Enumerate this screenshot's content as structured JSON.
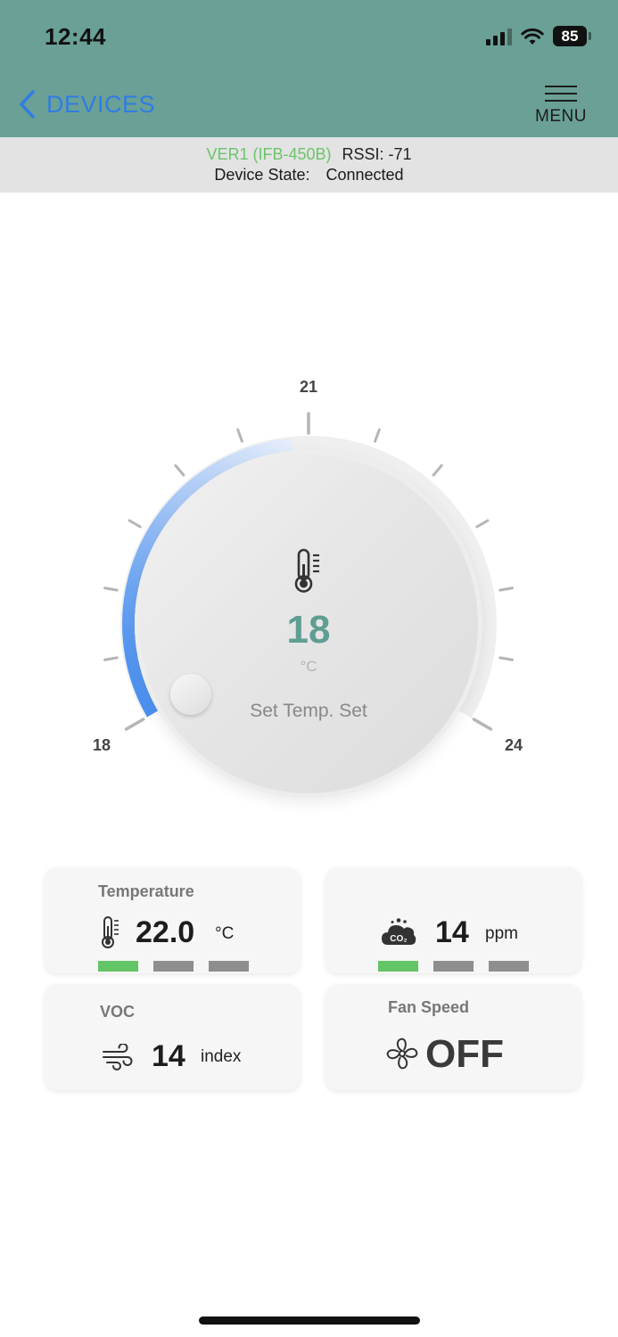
{
  "status_bar": {
    "time": "12:44",
    "battery": "85"
  },
  "nav": {
    "back_label": "DEVICES",
    "menu_label": "MENU"
  },
  "device_info": {
    "name": "VER1 (IFB-450B)",
    "rssi_label": "RSSI: -71",
    "state_label": "Device State:",
    "state_value": "Connected"
  },
  "dial": {
    "value": "18",
    "unit": "°C",
    "label": "Set Temp. Set",
    "min_label": "18",
    "mid_label": "21",
    "max_label": "24",
    "min": 18,
    "max": 24,
    "current": 18
  },
  "cards": {
    "temperature": {
      "title": "Temperature",
      "value": "22.0",
      "unit": "°C",
      "icon": "thermometer-icon",
      "level": 1,
      "level_count": 3
    },
    "co2": {
      "value": "14",
      "unit": "ppm",
      "icon": "co2-cloud-icon",
      "level": 1,
      "level_count": 3
    },
    "voc": {
      "title": "VOC",
      "value": "14",
      "unit": "index",
      "icon": "wind-icon"
    },
    "fan": {
      "title": "Fan Speed",
      "value": "OFF",
      "icon": "fan-icon"
    }
  },
  "colors": {
    "header": "#6aa096",
    "accent_blue": "#2f7de1",
    "value_teal": "#5f9e93",
    "level_active": "#63c565",
    "level_inactive": "#8e8e8e"
  }
}
